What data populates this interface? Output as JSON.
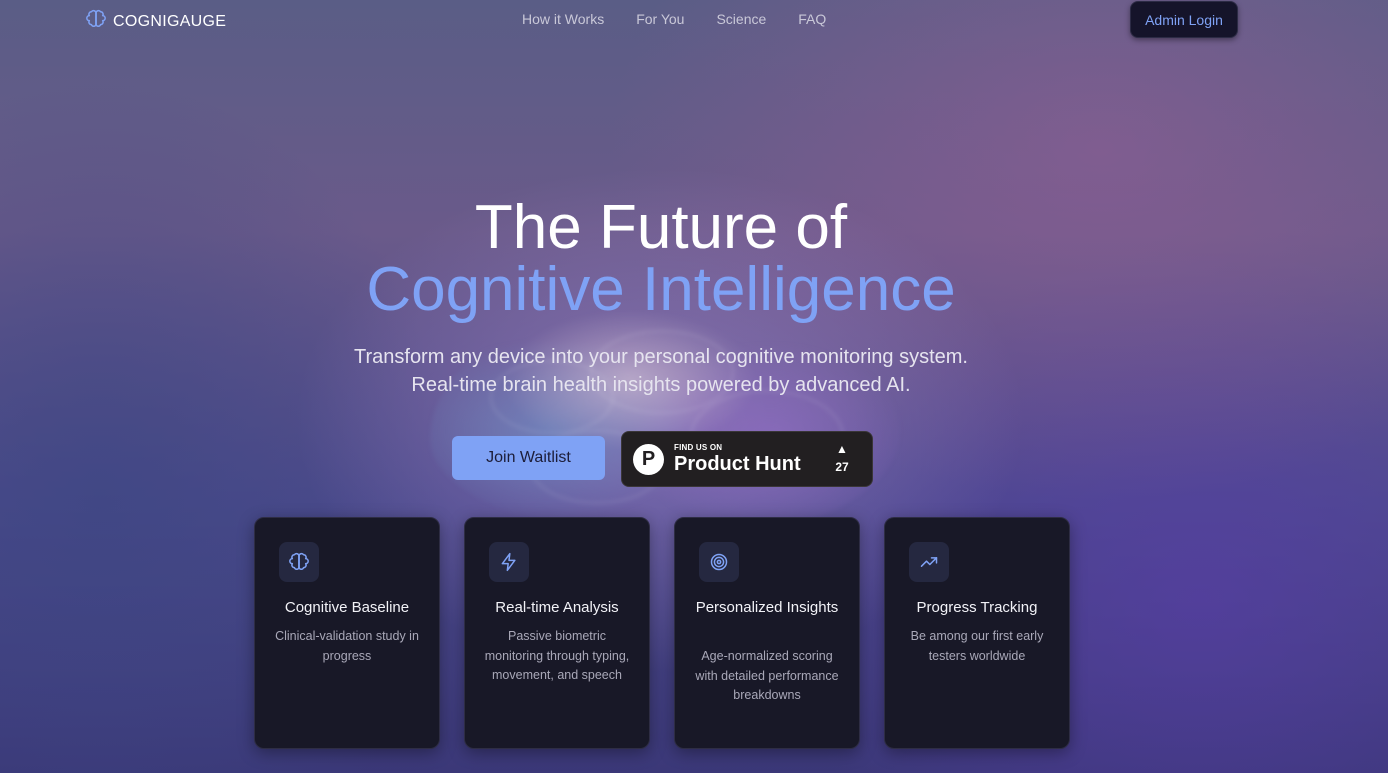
{
  "nav": {
    "brand": "COGNIGAUGE",
    "links": [
      "How it Works",
      "For You",
      "Science",
      "FAQ"
    ],
    "admin_label": "Admin Login"
  },
  "hero": {
    "title_line1": "The Future of",
    "title_line2": "Cognitive Intelligence",
    "subtitle": "Transform any device into your personal cognitive monitoring system. Real-time brain health insights powered by advanced AI.",
    "cta_label": "Join Waitlist"
  },
  "product_hunt": {
    "small_text": "FIND US ON",
    "big_text": "Product Hunt",
    "logo_letter": "P",
    "upvote_symbol": "▲",
    "upvotes": "27"
  },
  "cards": [
    {
      "icon": "brain-icon",
      "title": "Cognitive Baseline",
      "desc": "Clinical-validation study in progress"
    },
    {
      "icon": "lightning-icon",
      "title": "Real-time Analysis",
      "desc": "Passive biometric monitoring through typing, movement, and speech"
    },
    {
      "icon": "target-icon",
      "title": "Personalized Insights",
      "desc": "Age-normalized scoring with detailed performance breakdowns"
    },
    {
      "icon": "trending-up-icon",
      "title": "Progress Tracking",
      "desc": "Be among our first early testers worldwide"
    }
  ],
  "colors": {
    "accent": "#7fa2f5",
    "card_bg": "#181827",
    "card_icon_bg": "#252840",
    "ph_badge_bg": "#221f21"
  }
}
